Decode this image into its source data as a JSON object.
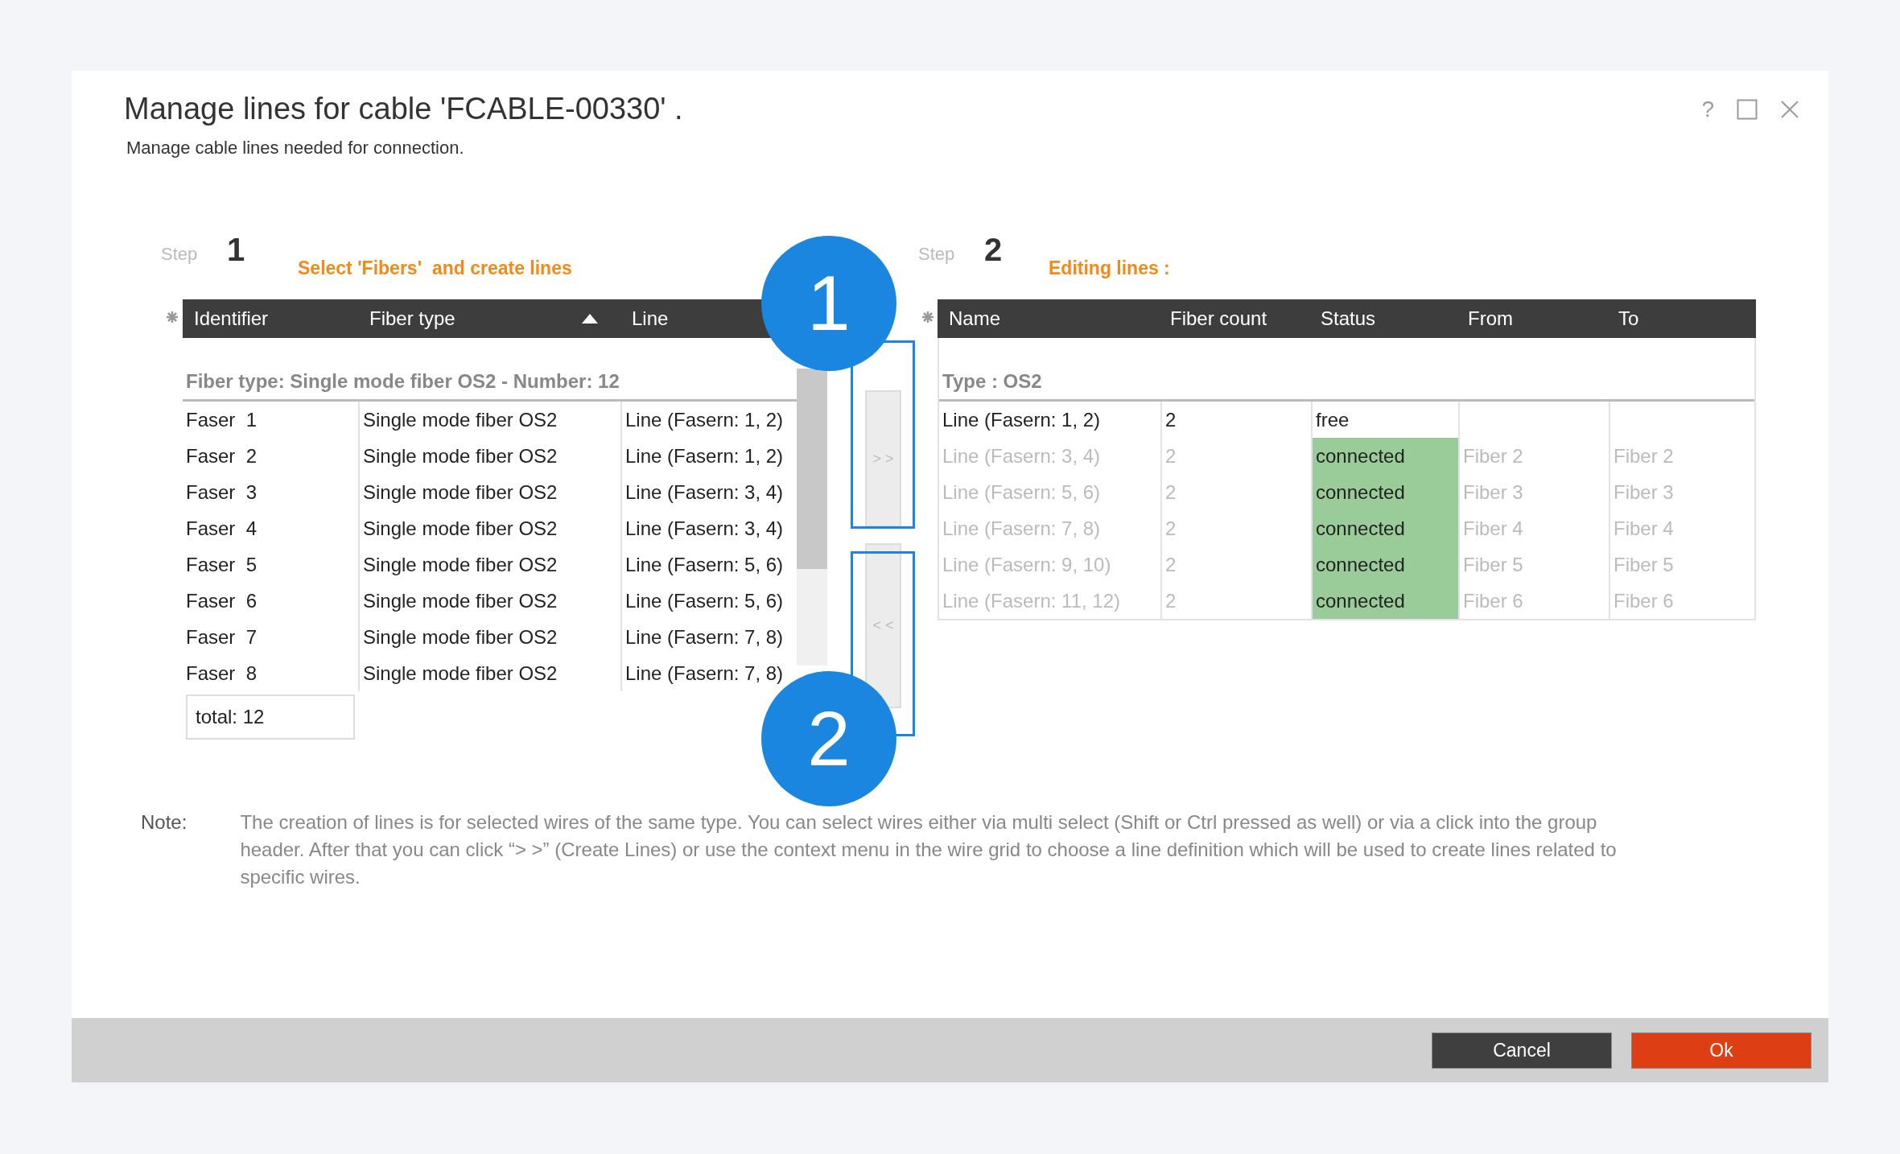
{
  "dialog": {
    "title": "Manage lines for cable 'FCABLE-00330' .",
    "subtitle": "Manage cable lines needed for connection.",
    "help": "?"
  },
  "step1": {
    "label": "Step",
    "number": "1",
    "heading": "Select 'Fibers'  and create lines"
  },
  "fiber_grid": {
    "columns": [
      {
        "label": "Identifier",
        "sorted": false
      },
      {
        "label": "Fiber type",
        "sorted": true
      },
      {
        "label": "Line",
        "sorted": false
      }
    ],
    "group": "Fiber type: Single mode fiber OS2 - Number: 12",
    "rows": [
      [
        "Faser  1",
        "Single mode fiber OS2",
        "Line (Fasern: 1, 2)"
      ],
      [
        "Faser  2",
        "Single mode fiber OS2",
        "Line (Fasern: 1, 2)"
      ],
      [
        "Faser  3",
        "Single mode fiber OS2",
        "Line (Fasern: 3, 4)"
      ],
      [
        "Faser  4",
        "Single mode fiber OS2",
        "Line (Fasern: 3, 4)"
      ],
      [
        "Faser  5",
        "Single mode fiber OS2",
        "Line (Fasern: 5, 6)"
      ],
      [
        "Faser  6",
        "Single mode fiber OS2",
        "Line (Fasern: 5, 6)"
      ],
      [
        "Faser  7",
        "Single mode fiber OS2",
        "Line (Fasern: 7, 8)"
      ],
      [
        "Faser  8",
        "Single mode fiber OS2",
        "Line (Fasern: 7, 8)"
      ]
    ],
    "total": "total: 12"
  },
  "transfer_buttons": [
    {
      "label": "> >",
      "disabled": true
    },
    {
      "label": "< <",
      "disabled": true
    }
  ],
  "step2": {
    "label": "Step",
    "number": "2",
    "heading": "Editing lines :"
  },
  "line_grid": {
    "columns": [
      "Name",
      "Fiber count",
      "Status",
      "From",
      "To"
    ],
    "group": "Type : OS2",
    "rows": [
      {
        "name": "Line (Fasern: 1, 2)",
        "fiber_count": "2",
        "status": "free",
        "connected": false,
        "disabled": false
      },
      {
        "name": "Line (Fasern: 3, 4)",
        "fiber_count": "2",
        "status": "connected",
        "connected": true,
        "disabled": true,
        "from": "Fiber 2",
        "to": "Fiber 2"
      },
      {
        "name": "Line (Fasern: 5, 6)",
        "fiber_count": "2",
        "status": "connected",
        "connected": true,
        "disabled": true,
        "from": "Fiber 3",
        "to": "Fiber 3"
      },
      {
        "name": "Line (Fasern: 7, 8)",
        "fiber_count": "2",
        "status": "connected",
        "connected": true,
        "disabled": true,
        "from": "Fiber 4",
        "to": "Fiber 4"
      },
      {
        "name": "Line (Fasern: 9, 10)",
        "fiber_count": "2",
        "status": "connected",
        "connected": true,
        "disabled": true,
        "from": "Fiber 5",
        "to": "Fiber 5"
      },
      {
        "name": "Line (Fasern: 11, 12)",
        "fiber_count": "2",
        "status": "connected",
        "connected": true,
        "disabled": true,
        "from": "Fiber 6",
        "to": "Fiber 6"
      }
    ]
  },
  "note": {
    "label": "Note:",
    "text": "The creation of lines is for selected wires of the same type. You can select wires either via multi select (Shift or Ctrl pressed as well) or via a click into the group header. After that you can click “> >” (Create Lines) or use the context menu in the wire grid to choose a line definition which will be used to create lines related to specific wires."
  },
  "buttons": [
    {
      "label": "Cancel",
      "kind": "secondary"
    },
    {
      "label": "Ok",
      "kind": "primary"
    }
  ],
  "callouts": [
    {
      "number": "1"
    },
    {
      "number": "2"
    }
  ]
}
